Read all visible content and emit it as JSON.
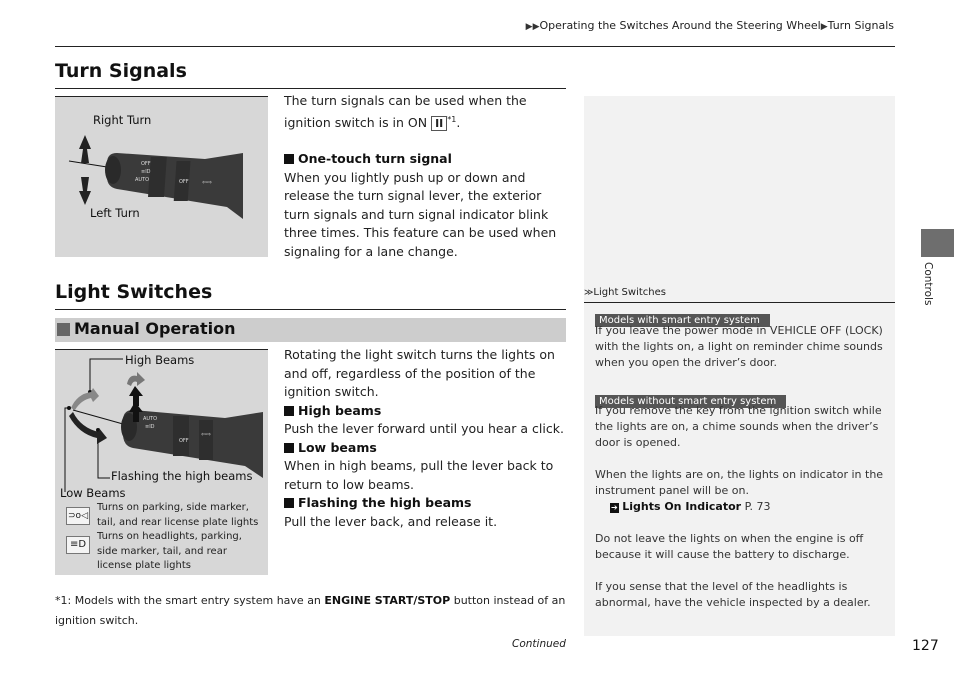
{
  "breadcrumb": {
    "items": [
      "Operating the Switches Around the Steering Wheel",
      "Turn Signals"
    ]
  },
  "turn_signals": {
    "title": "Turn Signals",
    "figure": {
      "label_right": "Right Turn",
      "label_left": "Left Turn"
    },
    "intro_before": "The turn signals can be used when the ignition switch is in ON ",
    "ignition_mode": "II",
    "footnote_ref": "*1",
    "intro_after": ".",
    "one_touch_heading": "One-touch turn signal",
    "one_touch_text": "When you lightly push up or down and release the turn signal lever, the exterior turn signals and turn signal indicator blink three times. This feature can be used when signaling for a lane change."
  },
  "light_switches": {
    "title": "Light Switches",
    "subsection": "Manual Operation",
    "figure": {
      "label_high": "High Beams",
      "label_flash": "Flashing the high beams",
      "label_low": "Low Beams",
      "legend": [
        {
          "icon": "parking-lights-icon",
          "text": "Turns on parking, side marker, tail, and rear license plate lights"
        },
        {
          "icon": "headlights-icon",
          "text": "Turns on headlights, parking, side marker, tail, and rear license plate lights"
        }
      ]
    },
    "intro": "Rotating the light switch turns the lights on and off, regardless of the position of the ignition switch.",
    "items": [
      {
        "heading": "High beams",
        "text": "Push the lever forward until you hear a click."
      },
      {
        "heading": "Low beams",
        "text": "When in high beams, pull the lever back to return to low beams."
      },
      {
        "heading": "Flashing the high beams",
        "text": "Pull the lever back, and release it."
      }
    ]
  },
  "side_notes": {
    "title": "Light Switches",
    "tag_with": "Models with smart entry system",
    "text_with": "If you leave the power mode in VEHICLE OFF (LOCK) with the lights on, a light on reminder chime sounds when you open the driver’s door.",
    "tag_without": "Models without smart entry system",
    "text_without": "If you remove the key from the ignition switch while the lights are on, a chime sounds when the driver’s door is opened.",
    "text_indicator": "When the lights are on, the lights on indicator in the instrument panel will be on.",
    "link_label": "Lights On Indicator",
    "link_page": "P. 73",
    "text_battery": "Do not leave the lights on when the engine is off because it will cause the battery to discharge.",
    "text_dealer": "If you sense that the level of the headlights is abnormal, have the vehicle inspected by a dealer."
  },
  "footnote": {
    "prefix": "*1: Models with the smart entry system have an ",
    "bold": "ENGINE START/STOP",
    "suffix": " button instead of an ignition switch."
  },
  "continued": "Continued",
  "chapter_tab": "Controls",
  "page_number": "127"
}
